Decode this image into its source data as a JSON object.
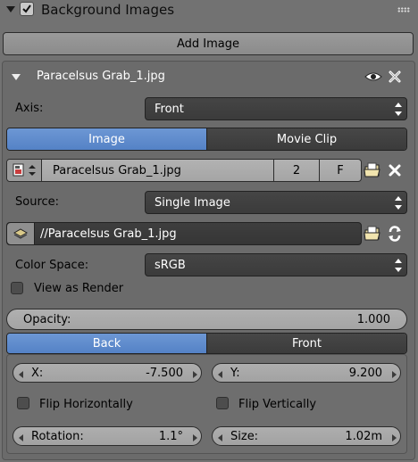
{
  "panel": {
    "title": "Background Images",
    "add_image_label": "Add Image"
  },
  "image_entry": {
    "name": "Paracelsus Grab_1.jpg",
    "axis_label": "Axis:",
    "axis_value": "Front",
    "source_tabs": [
      "Image",
      "Movie Clip"
    ],
    "active_source_tab": "Image",
    "datablock": {
      "name": "Paracelsus Grab_1.jpg",
      "users": "2",
      "fake_user": "F"
    },
    "source_label": "Source:",
    "source_value": "Single Image",
    "filepath": "//Paracelsus Grab_1.jpg",
    "color_space_label": "Color Space:",
    "color_space_value": "sRGB",
    "view_as_render_label": "View as Render",
    "view_as_render_checked": false,
    "opacity_label": "Opacity:",
    "opacity_value": "1.000",
    "depth_tabs": [
      "Back",
      "Front"
    ],
    "active_depth_tab": "Back",
    "offset": {
      "x_label": "X:",
      "x_value": "-7.500",
      "y_label": "Y:",
      "y_value": "9.200",
      "flip_h_label": "Flip Horizontally",
      "flip_h_checked": false,
      "flip_v_label": "Flip Vertically",
      "flip_v_checked": false,
      "rotation_label": "Rotation:",
      "rotation_value": "1.1°",
      "size_label": "Size:",
      "size_value": "1.02m"
    }
  },
  "colors": {
    "background": "#727272",
    "accent_blue": "#5f8dcd",
    "dark_widget": "#414141"
  }
}
